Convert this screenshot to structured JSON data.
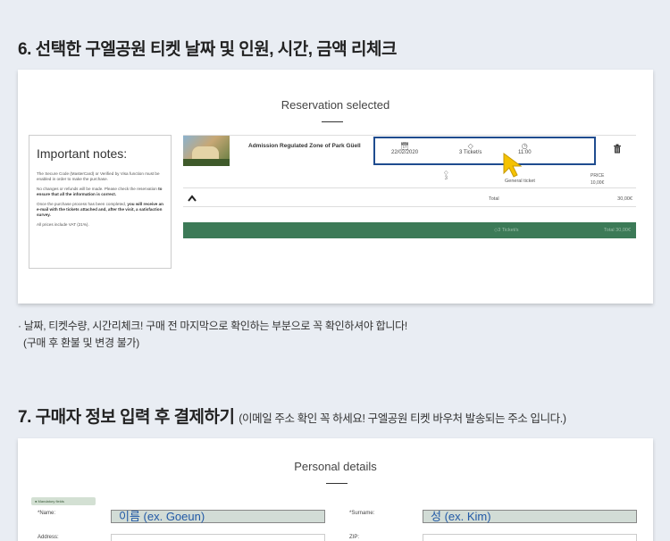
{
  "section6": {
    "heading": "6. 선택한 구엘공원 티켓 날짜 및 인원, 시간, 금액 리체크",
    "note_line1": "· 날짜, 티켓수량, 시간리체크! 구매 전 마지막으로 확인하는 부분으로 꼭 확인하셔야 합니다!",
    "note_line2": "(구매 후 환불 및 변경 불가)"
  },
  "reservation": {
    "title": "Reservation selected",
    "notes_title": "Important notes:",
    "notes": [
      "The Secure Code (MasterCard) or Verified by Visa function must be enabled in order to make the purchase.",
      "No changes or refunds will be made. Please check the reservation",
      "to ensure that all the information is correct.",
      "Once the purchase process has been completed,",
      "you will receive an e-mail with the tickets attached and, after the visit, a satisfaction survey.",
      "All prices include VAT (21%)."
    ],
    "product_name": "Admission Regulated Zone of Park Güell",
    "date": "22/02/2020",
    "tickets": "3 Ticket/s",
    "time": "11:00",
    "quantity": "3",
    "ticket_type": "General ticket",
    "price_label": "PRICE",
    "price_value": "10,00€",
    "total_label": "Total",
    "total_amount": "30,00€",
    "bar_tickets": "3 Ticket/s",
    "bar_total": "Total  30,00€"
  },
  "section7": {
    "heading": "7. 구매자 정보 입력 후 결제하기",
    "subheading": "(이메일 주소 확인 꼭 하세요! 구엘공원 티켓 바우처 발송되는 주소 입니다.)"
  },
  "personal": {
    "title": "Personal details",
    "mandatory": "Mandatory fields",
    "name_label": "*Name:",
    "name_value": "이름 (ex. Goeun)",
    "surname_label": "*Surname:",
    "surname_value": "성 (ex. Kim)",
    "address_label": "Address:",
    "zip_label": "ZIP:"
  },
  "colors": {
    "highlight_border": "#1f4c8f",
    "green_bar": "#3c7a57",
    "cursor": "#f5c200",
    "field_text": "#2259a6"
  }
}
